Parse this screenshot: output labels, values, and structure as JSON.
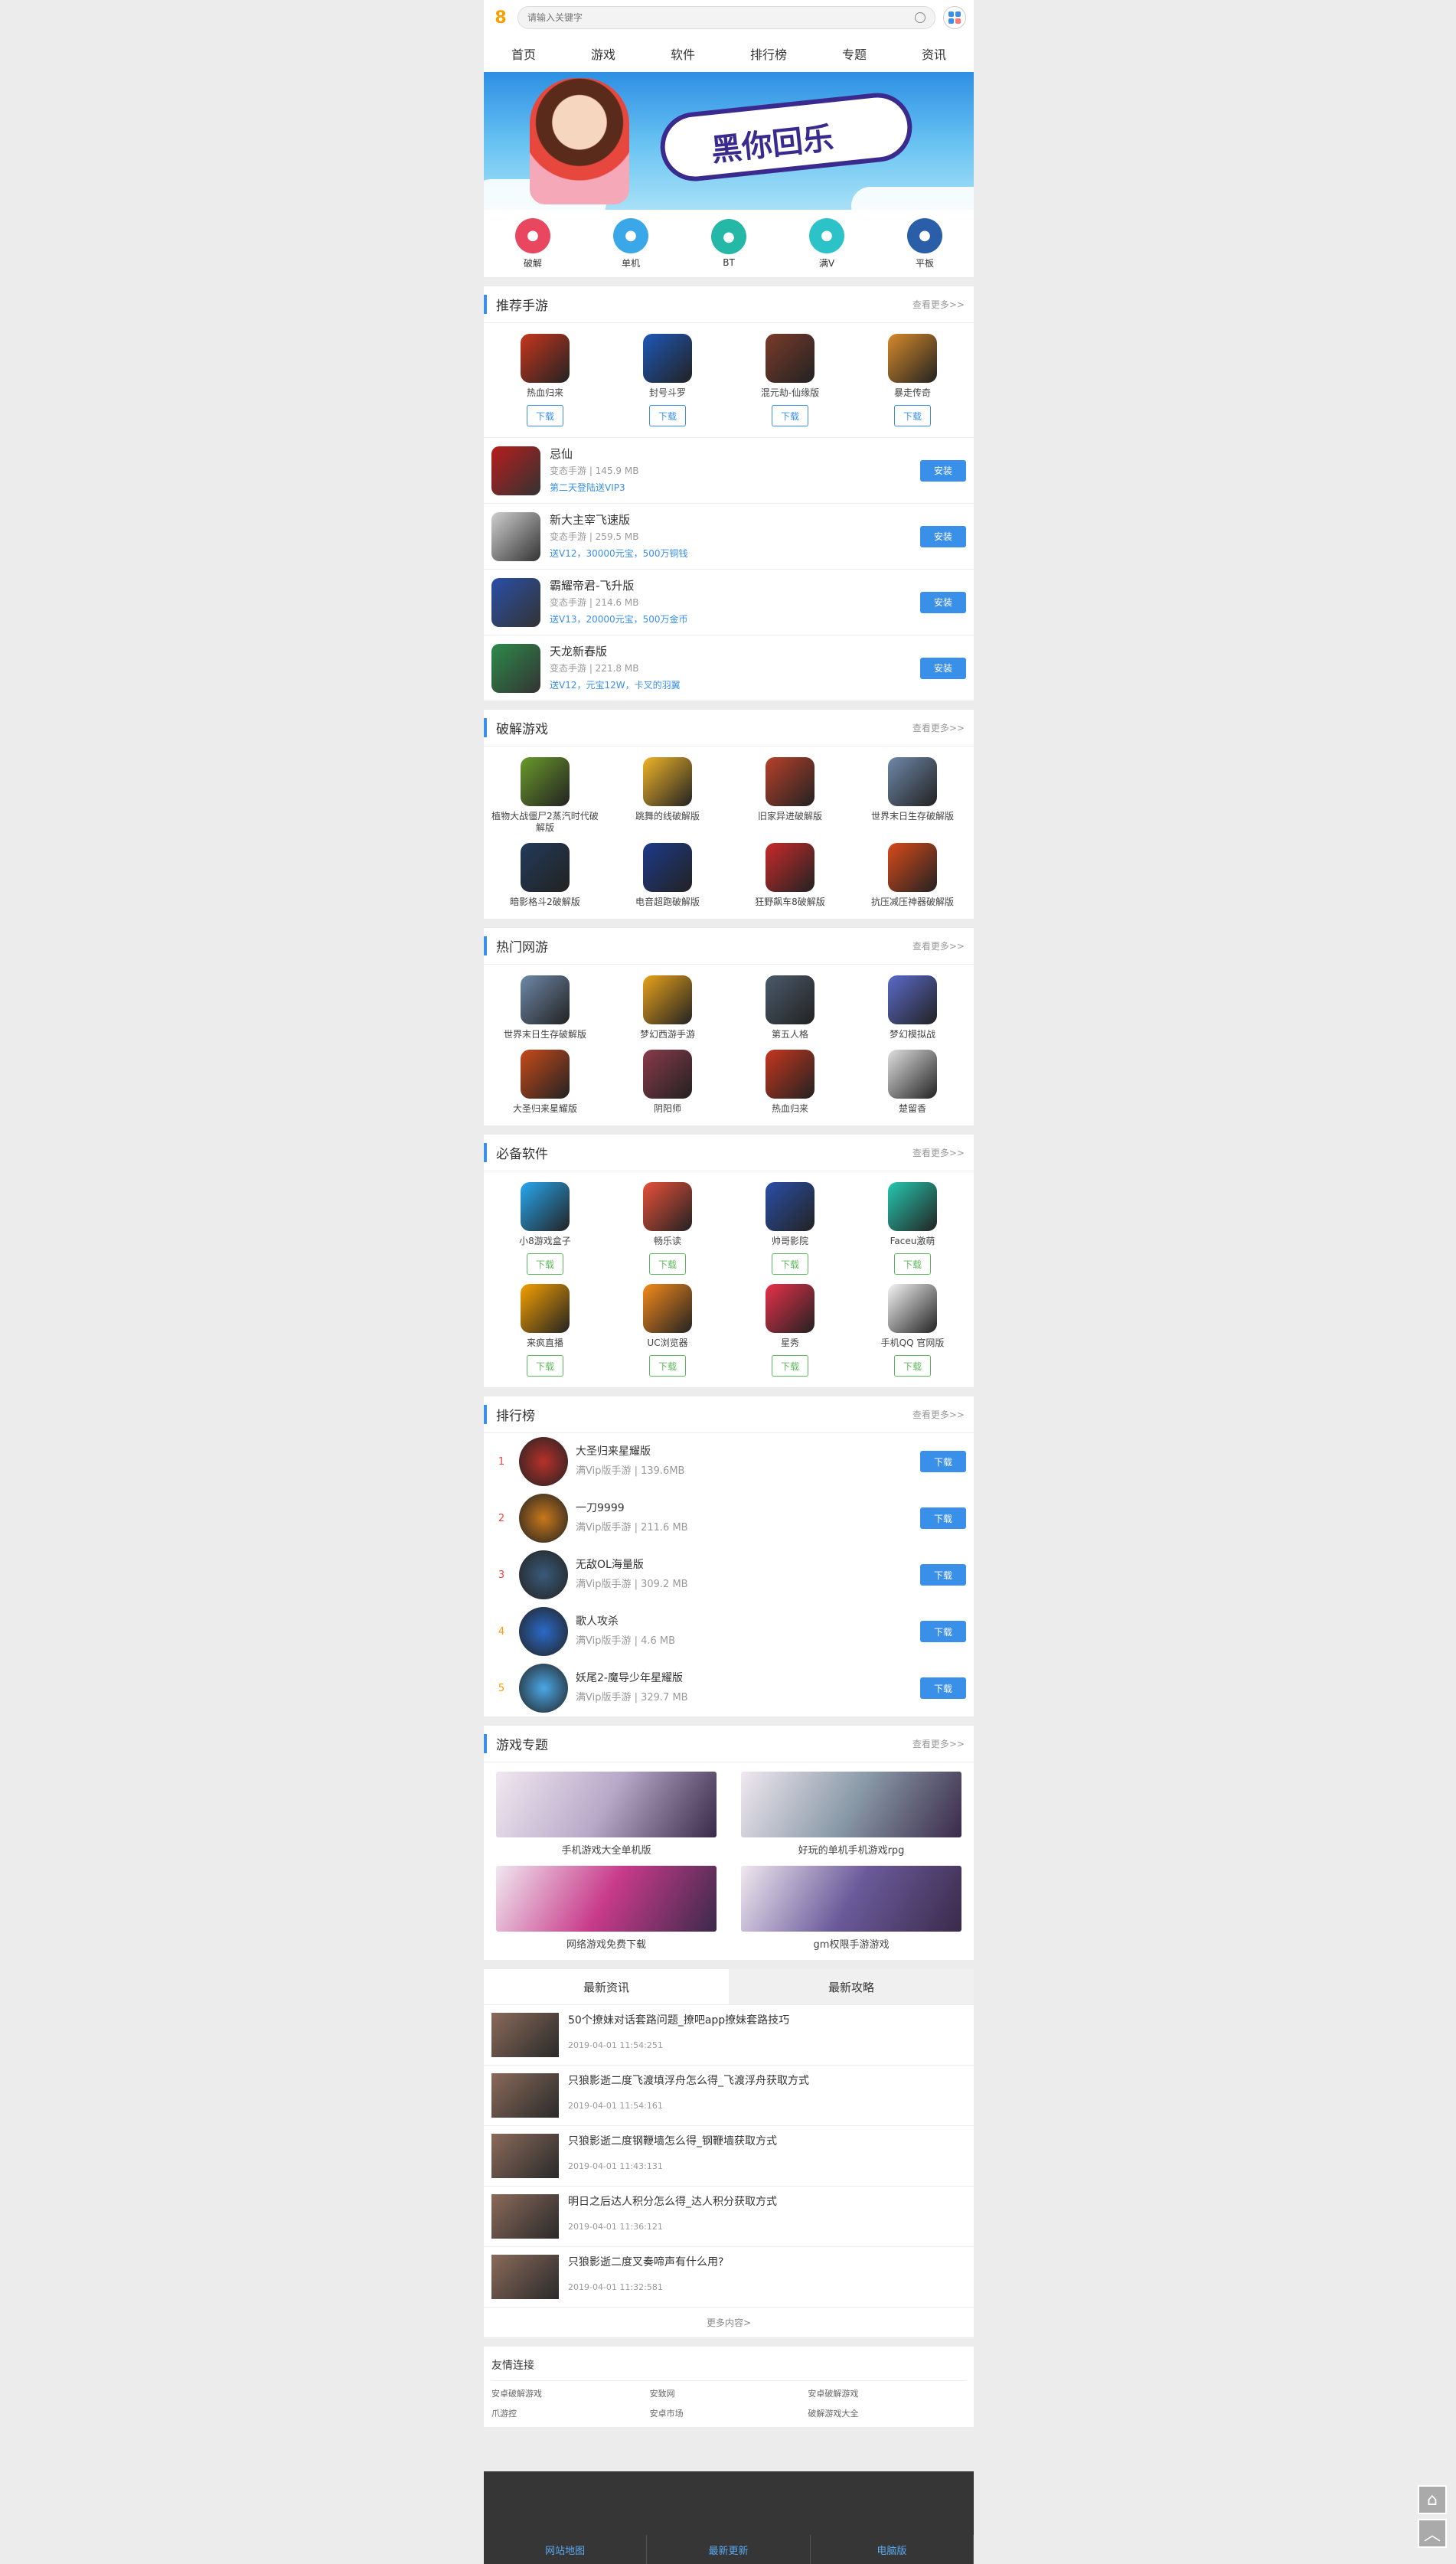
{
  "search": {
    "placeholder": "请输入关键字"
  },
  "nav": [
    "首页",
    "游戏",
    "软件",
    "排行榜",
    "专题",
    "资讯"
  ],
  "banner": {
    "title": "黑你回乐"
  },
  "categories": [
    {
      "label": "破解",
      "color": "#e8475f",
      "icon": "link-icon"
    },
    {
      "label": "单机",
      "color": "#3aa7e8",
      "icon": "grid-icon"
    },
    {
      "label": "BT",
      "color": "#25b8a6",
      "icon": "chart-icon"
    },
    {
      "label": "满V",
      "color": "#2bc3c8",
      "icon": "screen-icon"
    },
    {
      "label": "平板",
      "color": "#2b5ea8",
      "icon": "tablet-icon"
    }
  ],
  "recommend": {
    "title": "推荐手游",
    "more": "查看更多>>",
    "grid": [
      {
        "name": "热血归来",
        "color": "#c6361d"
      },
      {
        "name": "封号斗罗",
        "color": "#1e57b8"
      },
      {
        "name": "混元劫-仙缘版",
        "color": "#7a3b2a"
      },
      {
        "name": "暴走传奇",
        "color": "#d68a2a"
      }
    ],
    "download": "下载",
    "list": [
      {
        "name": "忌仙",
        "meta": "变态手游 | 145.9 MB",
        "hint": "第二天登陆送VIP3",
        "color": "#b71d1d"
      },
      {
        "name": "新大主宰飞速版",
        "meta": "变态手游 | 259.5 MB",
        "hint": "送V12，30000元宝，500万铜钱",
        "color": "#cfcfcf"
      },
      {
        "name": "霸耀帝君-飞升版",
        "meta": "变态手游 | 214.6 MB",
        "hint": "送V13，20000元宝，500万金币",
        "color": "#2a4fa8"
      },
      {
        "name": "天龙新春版",
        "meta": "变态手游 | 221.8 MB",
        "hint": "送V12，元宝12W，卡叉的羽翼",
        "color": "#2d8a4a"
      }
    ],
    "install": "安装"
  },
  "cracked": {
    "title": "破解游戏",
    "more": "查看更多>>",
    "items": [
      {
        "name": "植物大战僵尸2蒸汽时代破解版",
        "color": "#6a9a2a"
      },
      {
        "name": "跳舞的线破解版",
        "color": "#f0b428"
      },
      {
        "name": "旧家异进破解版",
        "color": "#b8402a"
      },
      {
        "name": "世界末日生存破解版",
        "color": "#6e88a8"
      },
      {
        "name": "暗影格斗2破解版",
        "color": "#223a5a"
      },
      {
        "name": "电音超跑破解版",
        "color": "#1d3a8a"
      },
      {
        "name": "狂野飙车8破解版",
        "color": "#c82a2a"
      },
      {
        "name": "抗压减压神器破解版",
        "color": "#d84a1a"
      }
    ]
  },
  "hotnet": {
    "title": "热门网游",
    "more": "查看更多>>",
    "items": [
      {
        "name": "世界末日生存破解版",
        "color": "#6e88a8"
      },
      {
        "name": "梦幻西游手游",
        "color": "#e8a21a"
      },
      {
        "name": "第五人格",
        "color": "#4a5a6a"
      },
      {
        "name": "梦幻模拟战",
        "color": "#5a6ac8"
      },
      {
        "name": "大圣归来星耀版",
        "color": "#c64a1a"
      },
      {
        "name": "阴阳师",
        "color": "#8a3a4a"
      },
      {
        "name": "热血归来",
        "color": "#c6361d"
      },
      {
        "name": "楚留香",
        "color": "#e0e0e0"
      }
    ]
  },
  "software": {
    "title": "必备软件",
    "more": "查看更多>>",
    "items": [
      {
        "name": "小8游戏盒子",
        "color": "#27a8f0"
      },
      {
        "name": "畅乐读",
        "color": "#e8503a"
      },
      {
        "name": "帅哥影院",
        "color": "#2a4fa8"
      },
      {
        "name": "Faceu激萌",
        "color": "#25c8b0"
      },
      {
        "name": "来疯直播",
        "color": "#f5a000"
      },
      {
        "name": "UC浏览器",
        "color": "#f58a1a"
      },
      {
        "name": "星秀",
        "color": "#e8304a"
      },
      {
        "name": "手机QQ 官网版",
        "color": "#f5f5f5"
      }
    ],
    "download": "下载"
  },
  "ranking": {
    "title": "排行榜",
    "more": "查看更多>>",
    "items": [
      {
        "no": "1",
        "name": "大圣归来星耀版",
        "meta": "满Vip版手游 | 139.6MB",
        "color": "#b8302a"
      },
      {
        "no": "2",
        "name": "一刀9999",
        "meta": "满Vip版手游 | 211.6 MB",
        "color": "#c8781a"
      },
      {
        "no": "3",
        "name": "无敌OL海量版",
        "meta": "满Vip版手游 | 309.2 MB",
        "color": "#3a5a7a"
      },
      {
        "no": "4",
        "name": "歌人攻杀",
        "meta": "满Vip版手游 | 4.6 MB",
        "color": "#2a6ac8"
      },
      {
        "no": "5",
        "name": "妖尾2-魔导少年星耀版",
        "meta": "满Vip版手游 | 329.7 MB",
        "color": "#4aa8e8"
      }
    ],
    "download": "下载"
  },
  "topics": {
    "title": "游戏专题",
    "more": "查看更多>>",
    "items": [
      {
        "name": "手机游戏大全单机版",
        "color": "#b8a8c8"
      },
      {
        "name": "好玩的单机手机游戏rpg",
        "color": "#8a9aa8"
      },
      {
        "name": "网络游戏免费下载",
        "color": "#c83a8a"
      },
      {
        "name": "gm权限手游游戏",
        "color": "#6a5a9a"
      }
    ]
  },
  "news": {
    "tabs": [
      "最新资讯",
      "最新攻略"
    ],
    "items": [
      {
        "title": "50个撩妹对话套路问题_撩吧app撩妹套路技巧",
        "date": "2019-04-01 11:54:251"
      },
      {
        "title": "只狼影逝二度飞渡填浮舟怎么得_飞渡浮舟获取方式",
        "date": "2019-04-01 11:54:161"
      },
      {
        "title": "只狼影逝二度钢鞭墙怎么得_钢鞭墙获取方式",
        "date": "2019-04-01 11:43:131"
      },
      {
        "title": "明日之后达人积分怎么得_达人积分获取方式",
        "date": "2019-04-01 11:36:121"
      },
      {
        "title": "只狼影逝二度叉奏啼声有什么用?",
        "date": "2019-04-01 11:32:581"
      }
    ],
    "more": "更多内容>"
  },
  "friends": {
    "title": "友情连接",
    "links": [
      "安卓破解游戏",
      "安致网",
      "安卓破解游戏",
      "爪游控",
      "安卓市场",
      "破解游戏大全"
    ]
  },
  "footer": [
    "网站地图",
    "最新更新",
    "电脑版"
  ]
}
